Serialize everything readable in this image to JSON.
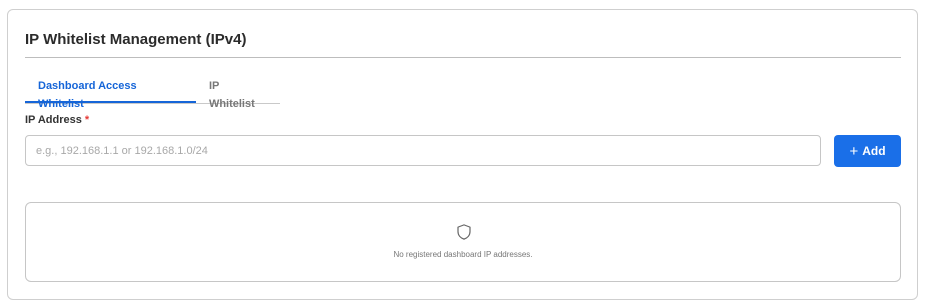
{
  "card": {
    "title": "IP Whitelist Management (IPv4)"
  },
  "tabs": [
    {
      "label": "Dashboard Access Whitelist",
      "active": true
    },
    {
      "label": "IP Whitelist",
      "active": false
    }
  ],
  "form": {
    "ip_label": "IP Address",
    "required_marker": "*",
    "ip_placeholder": "e.g., 192.168.1.1 or 192.168.1.0/24",
    "ip_value": "",
    "add_icon": "plus-icon",
    "add_label": "Add"
  },
  "empty_state": {
    "icon": "shield-icon",
    "message": "No registered dashboard IP addresses."
  },
  "colors": {
    "accent": "#1a6fe8",
    "active_tab": "#1565d8",
    "required": "#e53935"
  }
}
